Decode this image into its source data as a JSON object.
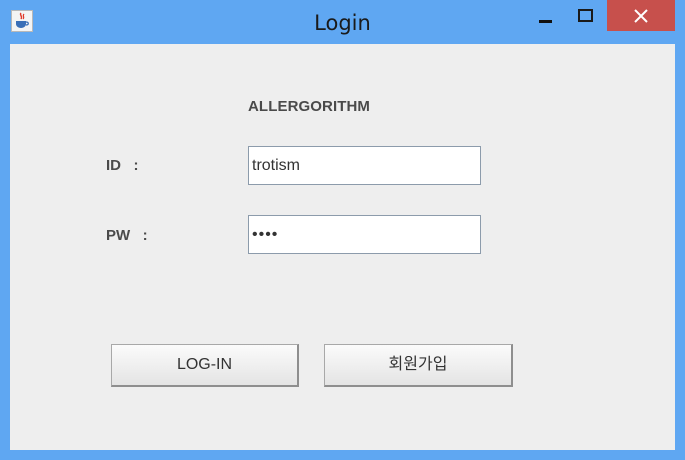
{
  "window": {
    "title": "Login",
    "icon": "java-coffee-cup-icon",
    "controls": {
      "minimize": "minimize-icon",
      "maximize": "maximize-icon",
      "close": "close-icon"
    },
    "accent_color": "#5fa7f2",
    "close_color": "#c7504c"
  },
  "form": {
    "brand": "ALLERGORITHM",
    "id_label": "ID   :",
    "id_value": "trotism",
    "pw_label": "PW   :",
    "pw_value": "••••"
  },
  "buttons": {
    "login_label": "LOG-IN",
    "signup_label": "회원가입"
  }
}
